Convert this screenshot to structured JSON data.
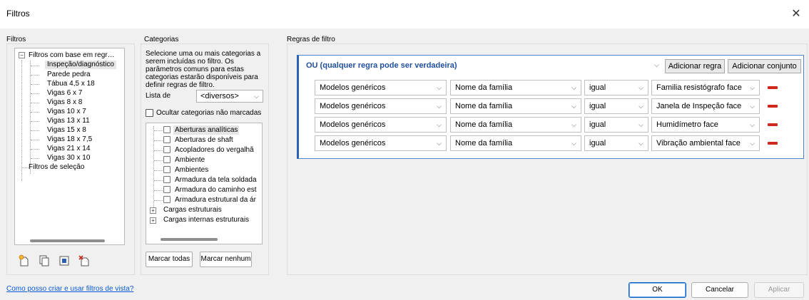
{
  "window": {
    "title": "Filtros",
    "close_glyph": "✕"
  },
  "filters_panel": {
    "label": "Filtros",
    "tree": [
      {
        "label": "Filtros com base em regr…",
        "level": 0,
        "expander": "−"
      },
      {
        "label": "Inspeção/diagnóstico",
        "level": 1,
        "selected": true
      },
      {
        "label": "Parede pedra",
        "level": 1
      },
      {
        "label": "Tábua 4,5 x 18",
        "level": 1
      },
      {
        "label": "Vigas 6 x 7",
        "level": 1
      },
      {
        "label": "Vigas 8 x 8",
        "level": 1
      },
      {
        "label": "Vigas 10 x 7",
        "level": 1
      },
      {
        "label": "Vigas 13 x 11",
        "level": 1
      },
      {
        "label": "Vigas 15 x 8",
        "level": 1
      },
      {
        "label": "Vigas 18 x 7,5",
        "level": 1
      },
      {
        "label": "Vigas 21 x 14",
        "level": 1
      },
      {
        "label": "Vigas 30 x 10",
        "level": 1
      },
      {
        "label": "Filtros de seleção",
        "level": 0
      }
    ],
    "tools": [
      "new-filter-icon",
      "duplicate-filter-icon",
      "rename-filter-icon",
      "delete-filter-icon"
    ]
  },
  "categories_panel": {
    "label": "Categorias",
    "description": "Selecione uma ou mais categorias a serem incluídas no filtro. Os parâmetros comuns para estas categorias estarão disponíveis para definir regras de filtro.",
    "list_label": "Lista de",
    "list_value": "<diversos>",
    "hide_unchecked_label": "Ocultar categorias não marcadas",
    "items": [
      {
        "label": "Aberturas analíticas",
        "type": "check",
        "selected": true
      },
      {
        "label": "Aberturas de shaft",
        "type": "check"
      },
      {
        "label": "Acopladores do vergalhã",
        "type": "check"
      },
      {
        "label": "Ambiente",
        "type": "check"
      },
      {
        "label": "Ambientes",
        "type": "check"
      },
      {
        "label": "Armadura da tela soldada",
        "type": "check"
      },
      {
        "label": "Armadura do caminho est",
        "type": "check"
      },
      {
        "label": "Armadura estrutural da ár",
        "type": "check"
      },
      {
        "label": "Cargas estruturais",
        "type": "group"
      },
      {
        "label": "Cargas internas estruturais",
        "type": "group"
      }
    ],
    "check_all": "Marcar todas",
    "check_none": "Marcar nenhum"
  },
  "rules_panel": {
    "label": "Regras de filtro",
    "operator": "OU (qualquer regra pode ser verdadeira)",
    "add_rule": "Adicionar regra",
    "add_set": "Adicionar conjunto",
    "rules": [
      {
        "category": "Modelos genéricos",
        "parameter": "Nome da família",
        "operator": "igual",
        "value": "Familia resistógrafo face"
      },
      {
        "category": "Modelos genéricos",
        "parameter": "Nome da família",
        "operator": "igual",
        "value": "Janela de Inspeção face"
      },
      {
        "category": "Modelos genéricos",
        "parameter": "Nome da família",
        "operator": "igual",
        "value": "Humidímetro face"
      },
      {
        "category": "Modelos genéricos",
        "parameter": "Nome da família",
        "operator": "igual",
        "value": "Vibração ambiental face"
      }
    ],
    "remove_color": "#d0281f"
  },
  "footer": {
    "help_link": "Como posso criar e usar filtros de vista?",
    "ok": "OK",
    "cancel": "Cancelar",
    "apply": "Aplicar"
  }
}
